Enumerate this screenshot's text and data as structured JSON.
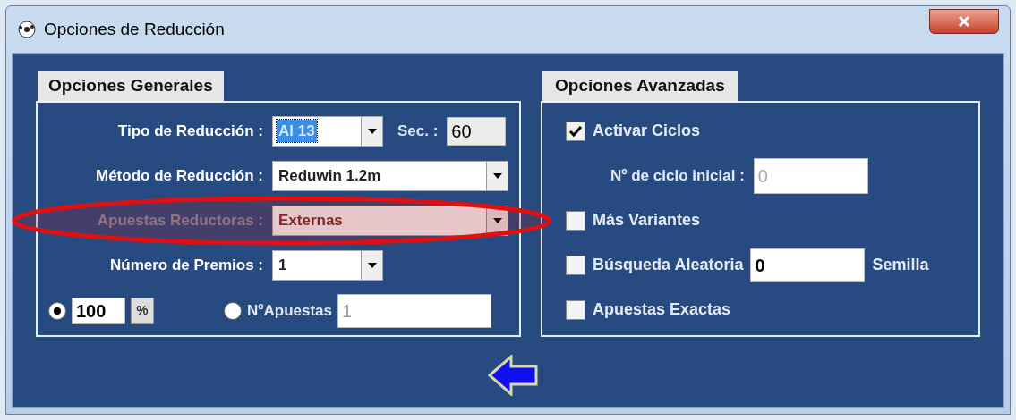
{
  "window": {
    "title": "Opciones de Reducción"
  },
  "general": {
    "title": "Opciones Generales",
    "rows": [
      {
        "kind": "narrow",
        "label": "Tipo de Reducción :",
        "value": "Al 13",
        "highlighted": true,
        "disabled": false,
        "extra_label": "Sec. :",
        "extra_value": "60"
      },
      {
        "kind": "wide",
        "label": "Método de Reducción :",
        "value": "Reduwin 1.2m",
        "highlighted": false,
        "disabled": false
      },
      {
        "kind": "wide",
        "label": "Apuestas Reductoras :",
        "value": "Externas",
        "highlighted": false,
        "disabled": true
      },
      {
        "kind": "narrow",
        "label": "Número de Premios :",
        "value": "1",
        "highlighted": false,
        "disabled": false
      }
    ],
    "percent": {
      "selected": true,
      "value": "100",
      "button": "%"
    },
    "bets": {
      "selected": false,
      "label": "NºApuestas",
      "value": "1"
    }
  },
  "advanced": {
    "title": "Opciones Avanzadas",
    "items": [
      {
        "kind": "check",
        "label": "Activar Ciclos",
        "checked": true
      },
      {
        "kind": "field",
        "label": "Nº de ciclo inicial :",
        "value": "0",
        "dim": true
      },
      {
        "kind": "check",
        "label": "Más Variantes",
        "checked": false
      },
      {
        "kind": "check",
        "label": "Búsqueda Aleatoria",
        "checked": false,
        "value": "0",
        "suffix": "Semilla"
      },
      {
        "kind": "check",
        "label": "Apuestas Exactas",
        "checked": false
      }
    ]
  }
}
